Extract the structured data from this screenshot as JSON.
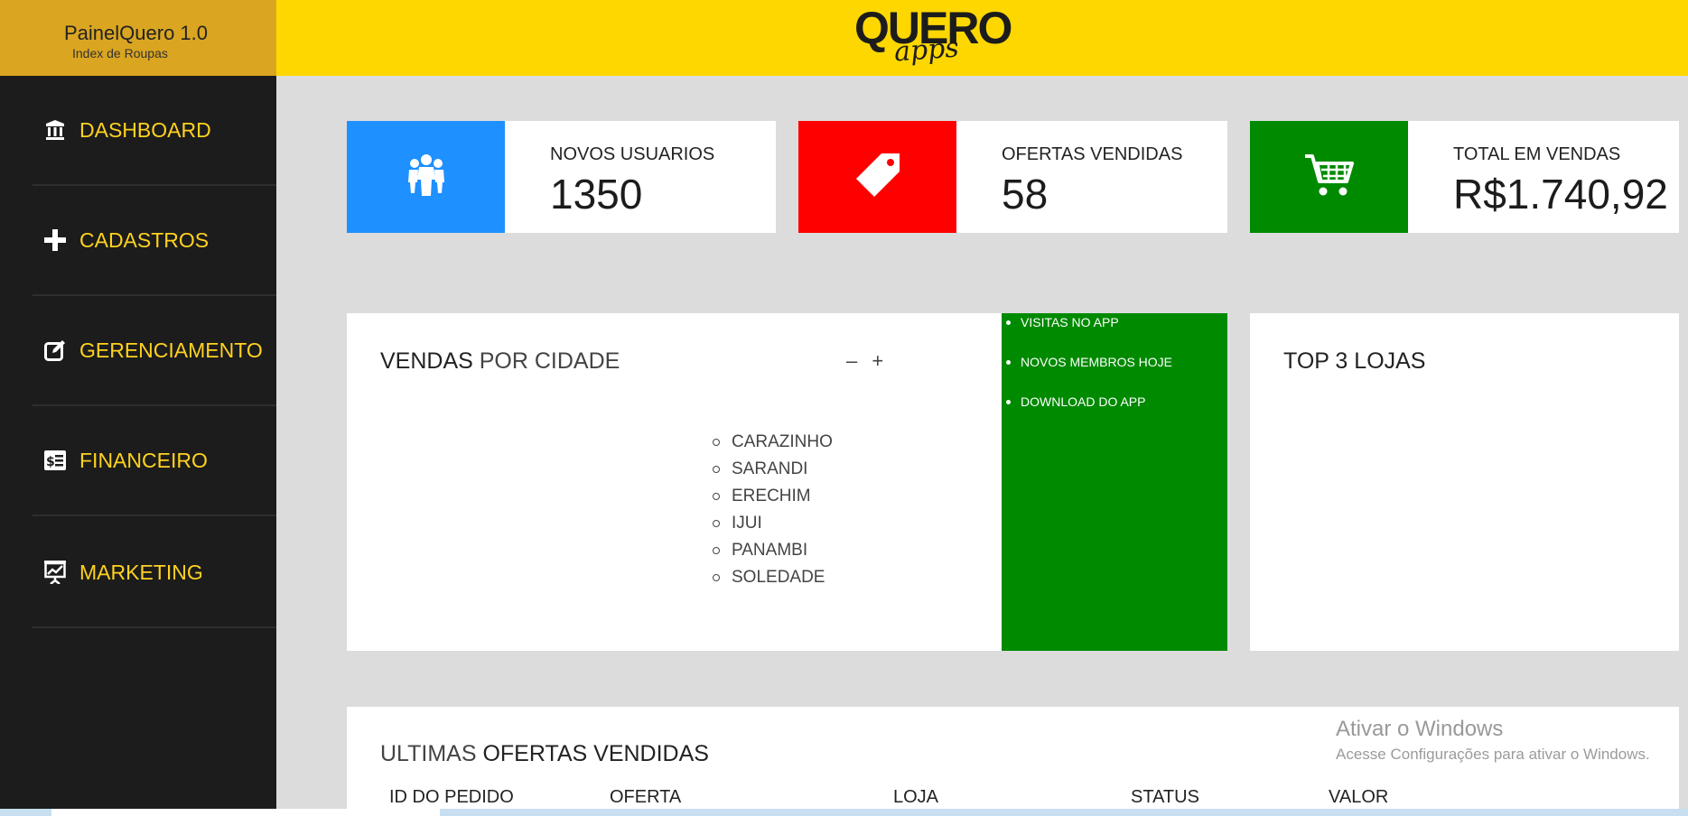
{
  "brand": {
    "title_light": "Painel",
    "title_bold": "Quero",
    "version": " 1.0",
    "subtitle": "Index de Roupas"
  },
  "logo": {
    "main": "QUERO",
    "script": "apps"
  },
  "sidebar": {
    "items": [
      {
        "label": "DASHBOARD",
        "icon": "bank-icon"
      },
      {
        "label": "CADASTROS",
        "icon": "plus-icon"
      },
      {
        "label": "GERENCIAMENTO",
        "icon": "edit-icon"
      },
      {
        "label": "FINANCEIRO",
        "icon": "money-receipt-icon"
      },
      {
        "label": "MARKETING",
        "icon": "presentation-chart-icon"
      }
    ]
  },
  "stats": [
    {
      "label": "NOVOS USUARIOS",
      "value": "1350",
      "color": "#1e90ff",
      "icon": "users-icon"
    },
    {
      "label": "OFERTAS VENDIDAS",
      "value": "58",
      "color": "#ff0000",
      "icon": "tag-icon"
    },
    {
      "label": "TOTAL EM VENDAS",
      "value": "R$1.740,92",
      "color": "#008a00",
      "icon": "cart-icon"
    }
  ],
  "vendas": {
    "title_bold": "VENDAS",
    "title_light": " POR CIDADE",
    "minimize": "–",
    "expand": "+",
    "cities": [
      "CARAZINHO",
      "SARANDI",
      "ERECHIM",
      "IJUI",
      "PANAMBI",
      "SOLEDADE"
    ]
  },
  "green_list": [
    "VISITAS NO APP",
    "NOVOS MEMBROS HOJE",
    "DOWNLOAD DO APP"
  ],
  "top_lojas": {
    "title": "TOP 3 LOJAS"
  },
  "ultimas": {
    "title_light": "ULTIMAS ",
    "title_bold": "OFERTAS VENDIDAS",
    "columns": [
      "ID DO PEDIDO",
      "OFERTA",
      "LOJA",
      "STATUS",
      "VALOR"
    ]
  },
  "watermark": {
    "line1": "Ativar o Windows",
    "line2": "Acesse Configurações para ativar o Windows."
  }
}
